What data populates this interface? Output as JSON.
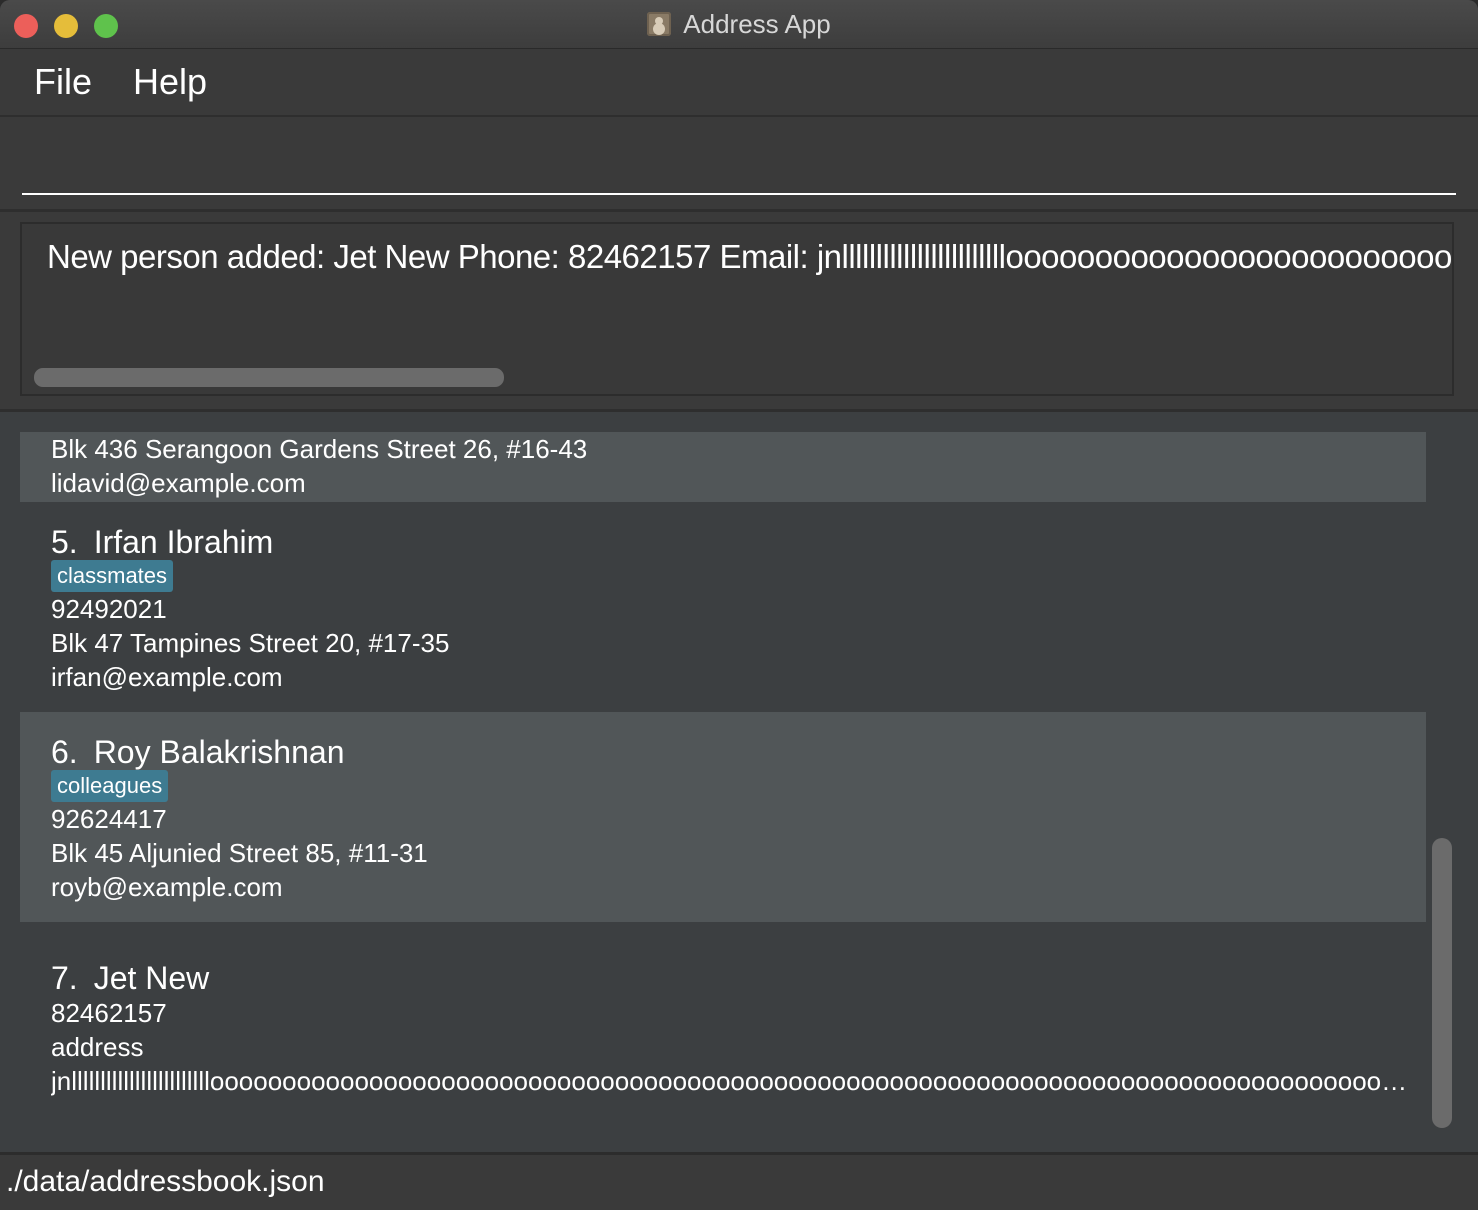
{
  "window": {
    "title": "Address App"
  },
  "menu": {
    "file": "File",
    "help": "Help"
  },
  "command": {
    "value": ""
  },
  "result": {
    "text": "New person added: Jet New Phone: 82462157 Email: jnlllllllllllllllllllllllloooooooooooooooooooooooooooooooooooo"
  },
  "persons": [
    {
      "address": "Blk 436 Serangoon Gardens Street 26, #16-43",
      "email": "lidavid@example.com"
    },
    {
      "index": "5.",
      "name": "Irfan Ibrahim",
      "tag": "classmates",
      "phone": "92492021",
      "address": "Blk 47 Tampines Street 20, #17-35",
      "email": "irfan@example.com"
    },
    {
      "index": "6.",
      "name": "Roy Balakrishnan",
      "tag": "colleagues",
      "phone": "92624417",
      "address": "Blk 45 Aljunied Street 85, #11-31",
      "email": "royb@example.com"
    },
    {
      "index": "7.",
      "name": "Jet New",
      "phone": "82462157",
      "address": "address",
      "email": "jnlllllllllllllllllllllllloooooooooooooooooooooooooooooooooooooooooooooooooooooooooooooooooooooooooooooooooooooooooooooooooooooooooooooooooo..."
    }
  ],
  "status": {
    "file_path": "./data/addressbook.json"
  },
  "colors": {
    "background": "#3c3f41",
    "card_selected": "#515658",
    "tag": "#3e7b91",
    "close": "#ec5f5a",
    "minimize": "#e5bd3a",
    "maximize": "#5fc24c"
  }
}
